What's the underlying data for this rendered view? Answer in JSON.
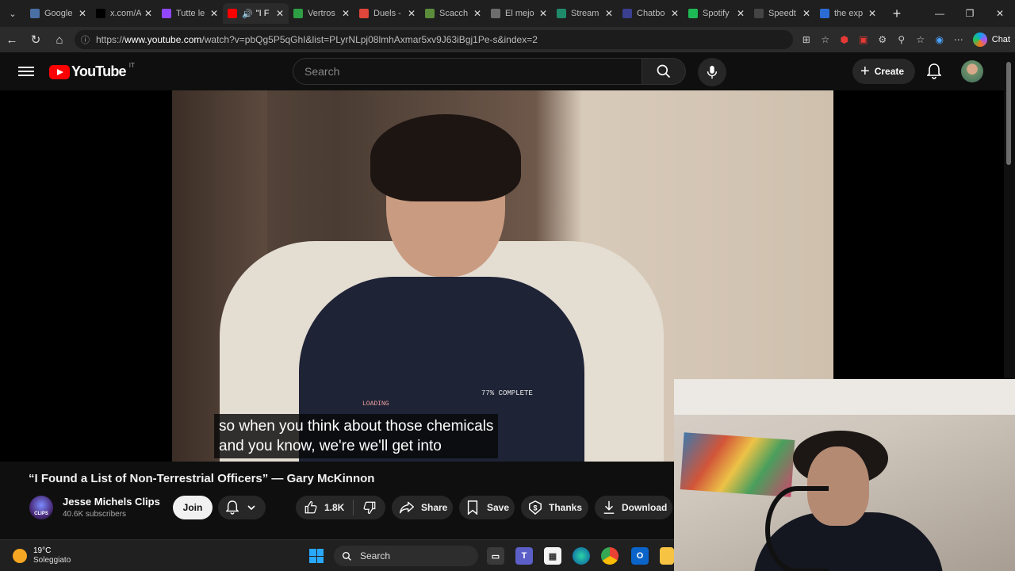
{
  "browser": {
    "tabs": [
      {
        "title": "Google",
        "favicon": "google-favicon-icon",
        "color": "#4a6fa5"
      },
      {
        "title": "x.com/A",
        "favicon": "x-favicon-icon",
        "color": "#000000"
      },
      {
        "title": "Tutte le",
        "favicon": "twitch-favicon-icon",
        "color": "#9146ff"
      },
      {
        "title": "\"I F",
        "favicon": "youtube-favicon-icon",
        "color": "#ff0000",
        "active": true,
        "audio": true
      },
      {
        "title": "Vertros",
        "favicon": "vertros-favicon-icon",
        "color": "#2e9e44"
      },
      {
        "title": "Duels -",
        "favicon": "duels-favicon-icon",
        "color": "#e0463a"
      },
      {
        "title": "Scacch",
        "favicon": "chess-favicon-icon",
        "color": "#5b8c3a"
      },
      {
        "title": "El mejo",
        "favicon": "el-mejor-favicon-icon",
        "color": "#6d6d6d"
      },
      {
        "title": "Stream",
        "favicon": "stream-favicon-icon",
        "color": "#1f8a6a"
      },
      {
        "title": "Chatbo",
        "favicon": "chatbot-favicon-icon",
        "color": "#3a3f8f"
      },
      {
        "title": "Spotify",
        "favicon": "spotify-favicon-icon",
        "color": "#1db954"
      },
      {
        "title": "Speedt",
        "favicon": "speedtest-favicon-icon",
        "color": "#444444"
      },
      {
        "title": "the exp",
        "favicon": "search-favicon-icon",
        "color": "#2b6cd4"
      }
    ],
    "url_prefix": "https://",
    "url_domain": "www.youtube.com",
    "url_path": "/watch?v=pbQg5P5qGhI&list=PLyrNLpj08lmhAxmar5xv9J63iBgj1Pe-s&index=2",
    "chat_label": "Chat"
  },
  "youtube": {
    "logo_text": "YouTube",
    "country_code": "IT",
    "search_placeholder": "Search",
    "create_label": "Create"
  },
  "video": {
    "caption_line1": "so when you think about those chemicals",
    "caption_line2": "and you know, we're we'll get into",
    "shirt_text": "77% COMPLETE",
    "shirt_loading": "LOADING",
    "title": "“I Found a List of Non-Terrestrial Officers” — Gary McKinnon"
  },
  "channel": {
    "name": "Jesse Michels Clips",
    "subscribers": "40.6K subscribers",
    "avatar_text": "CLIPS",
    "join_label": "Join"
  },
  "actions": {
    "likes": "1.8K",
    "share": "Share",
    "save": "Save",
    "thanks": "Thanks",
    "download": "Download"
  },
  "taskbar": {
    "temperature": "19°C",
    "weather": "Soleggiato",
    "search_label": "Search"
  }
}
